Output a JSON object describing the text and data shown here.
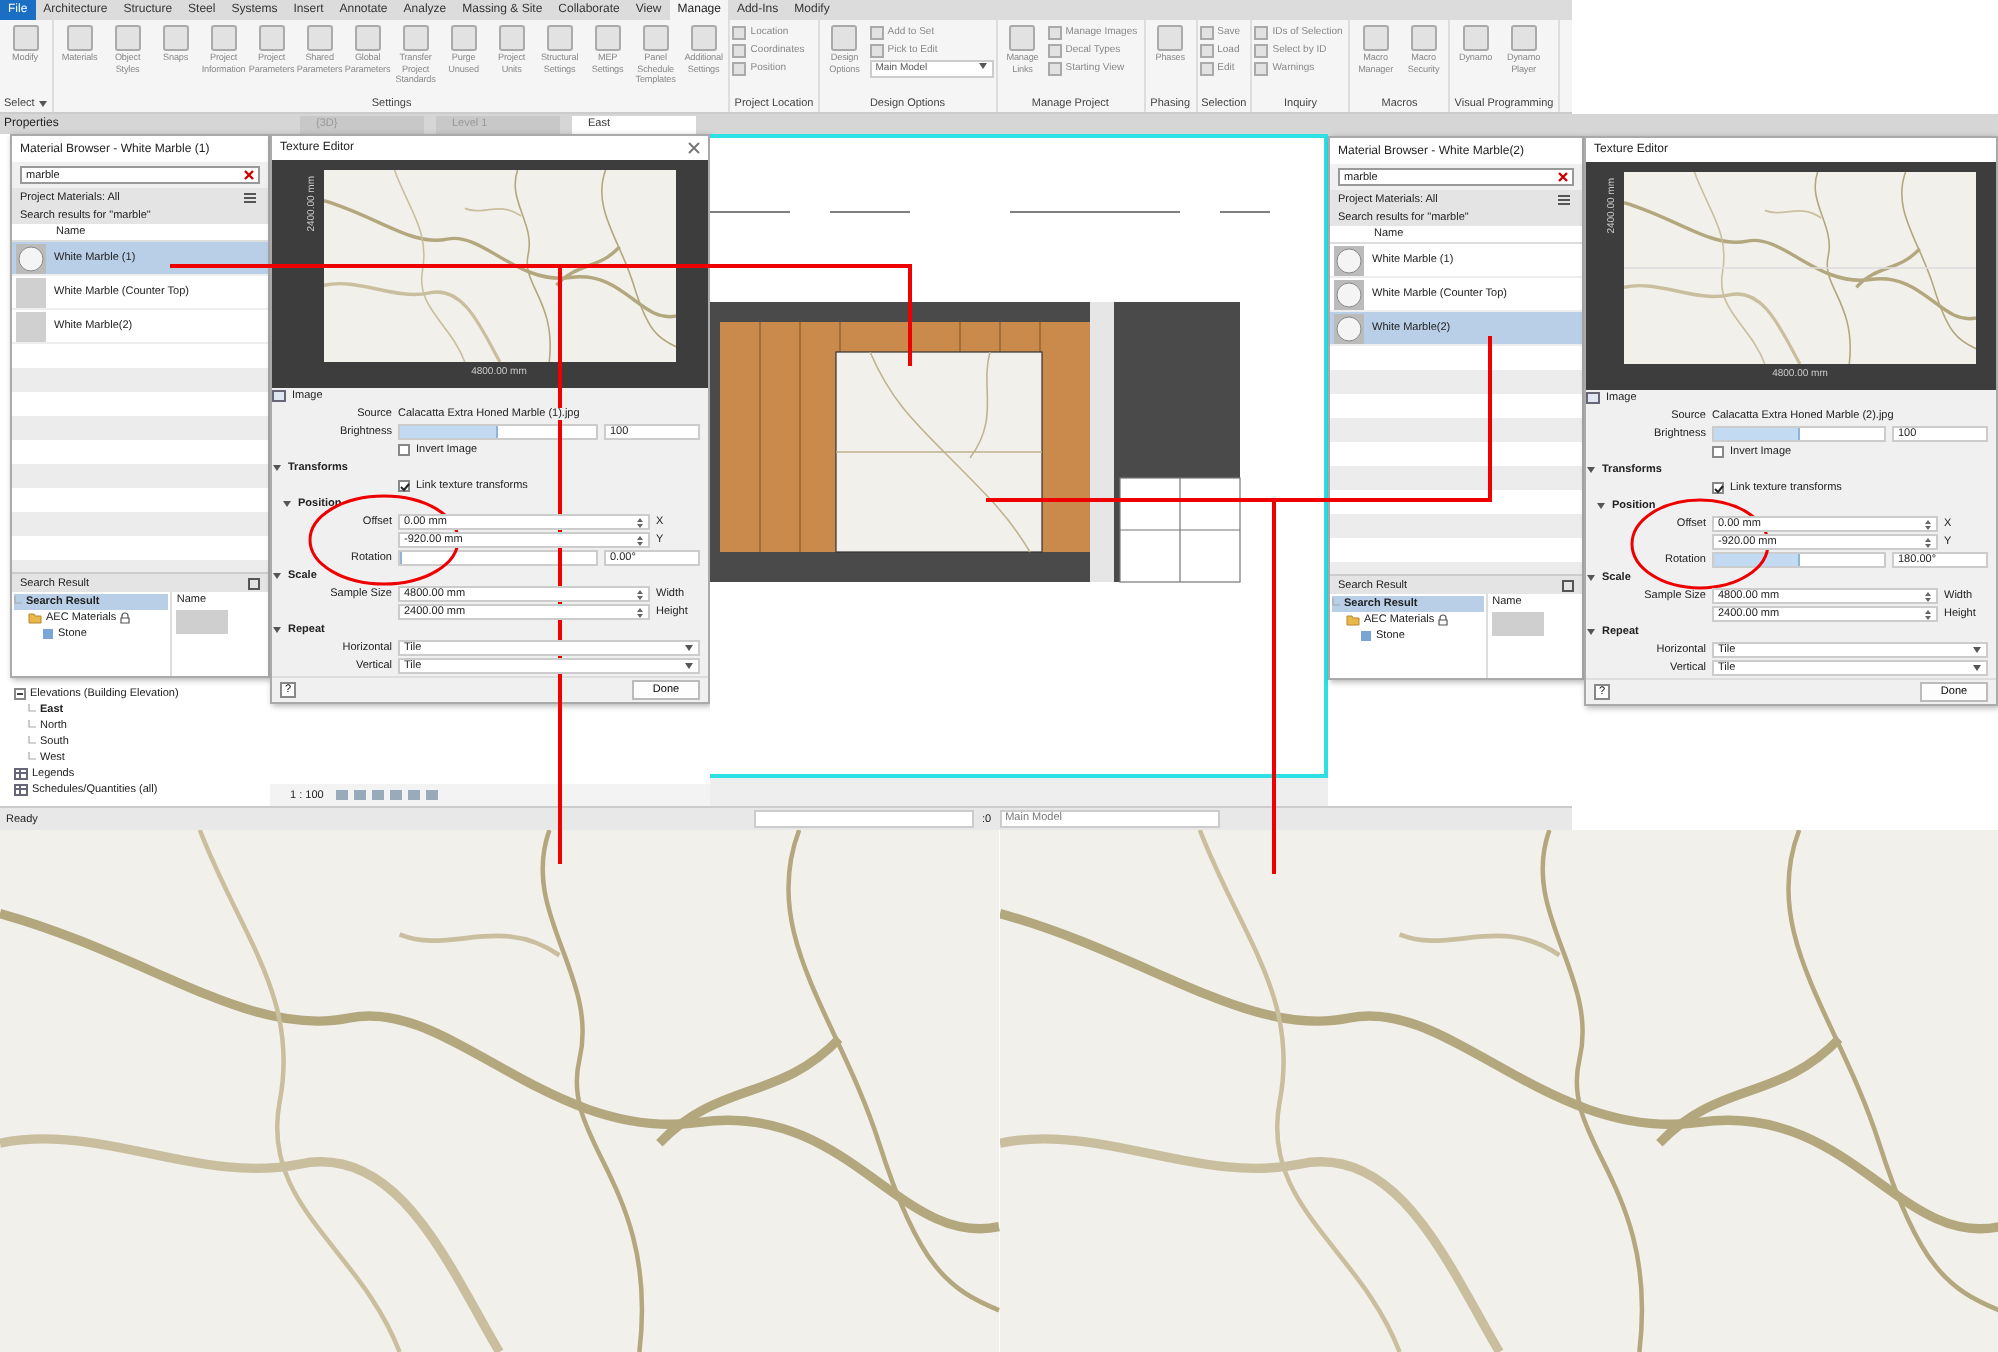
{
  "ribbon": {
    "tabs": [
      {
        "label": "File",
        "kind": "file",
        "selected": false
      },
      {
        "label": "Architecture",
        "kind": "tab",
        "selected": false
      },
      {
        "label": "Structure",
        "kind": "tab",
        "selected": false
      },
      {
        "label": "Steel",
        "kind": "tab",
        "selected": false
      },
      {
        "label": "Systems",
        "kind": "tab",
        "selected": false
      },
      {
        "label": "Insert",
        "kind": "tab",
        "selected": false
      },
      {
        "label": "Annotate",
        "kind": "tab",
        "selected": false
      },
      {
        "label": "Analyze",
        "kind": "tab",
        "selected": false
      },
      {
        "label": "Massing & Site",
        "kind": "tab",
        "selected": false
      },
      {
        "label": "Collaborate",
        "kind": "tab",
        "selected": false
      },
      {
        "label": "View",
        "kind": "tab",
        "selected": false
      },
      {
        "label": "Manage",
        "kind": "tab",
        "selected": true
      },
      {
        "label": "Add-Ins",
        "kind": "tab",
        "selected": false
      },
      {
        "label": "Modify",
        "kind": "tab",
        "selected": false
      }
    ],
    "groups": [
      {
        "label": "Select",
        "menu": true,
        "columns": [
          [
            {
              "label": "Modify",
              "kind": "large"
            }
          ]
        ]
      },
      {
        "label": "Settings",
        "menu": false,
        "columns": [
          [
            {
              "label": "Materials",
              "kind": "large"
            }
          ],
          [
            {
              "label": "Object Styles",
              "kind": "large"
            }
          ],
          [
            {
              "label": "Snaps",
              "kind": "large"
            }
          ],
          [
            {
              "label": "Project Information",
              "kind": "large"
            }
          ],
          [
            {
              "label": "Project Parameters",
              "kind": "large"
            }
          ],
          [
            {
              "label": "Shared Parameters",
              "kind": "large"
            }
          ],
          [
            {
              "label": "Global Parameters",
              "kind": "large"
            }
          ],
          [
            {
              "label": "Transfer Project Standards",
              "kind": "large"
            }
          ],
          [
            {
              "label": "Purge Unused",
              "kind": "large"
            }
          ],
          [
            {
              "label": "Project Units",
              "kind": "large"
            }
          ],
          [
            {
              "label": "Structural Settings",
              "kind": "large"
            }
          ],
          [
            {
              "label": "MEP Settings",
              "kind": "large"
            }
          ],
          [
            {
              "label": "Panel Schedule Templates",
              "kind": "large"
            }
          ],
          [
            {
              "label": "Additional Settings",
              "kind": "large"
            }
          ]
        ]
      },
      {
        "label": "Project Location",
        "menu": false,
        "columns": [
          [
            {
              "label": "Location",
              "kind": "small"
            },
            {
              "label": "Coordinates",
              "kind": "small"
            },
            {
              "label": "Position",
              "kind": "small"
            }
          ]
        ]
      },
      {
        "label": "Design Options",
        "menu": false,
        "columns": [
          [
            {
              "label": "Design Options",
              "kind": "large"
            }
          ],
          [
            {
              "label": "Add to Set",
              "kind": "small"
            },
            {
              "label": "Pick to Edit",
              "kind": "small"
            },
            {
              "label": "Main Model",
              "kind": "select"
            }
          ]
        ]
      },
      {
        "label": "Manage Project",
        "menu": false,
        "columns": [
          [
            {
              "label": "Manage Links",
              "kind": "large"
            }
          ],
          [
            {
              "label": "Manage Images",
              "kind": "small"
            },
            {
              "label": "Decal Types",
              "kind": "small"
            },
            {
              "label": "Starting View",
              "kind": "small"
            }
          ]
        ]
      },
      {
        "label": "Phasing",
        "menu": false,
        "columns": [
          [
            {
              "label": "Phases",
              "kind": "large"
            }
          ]
        ]
      },
      {
        "label": "Selection",
        "menu": false,
        "columns": [
          [
            {
              "label": "Save",
              "kind": "small"
            },
            {
              "label": "Load",
              "kind": "small"
            },
            {
              "label": "Edit",
              "kind": "small"
            }
          ]
        ]
      },
      {
        "label": "Inquiry",
        "menu": false,
        "columns": [
          [
            {
              "label": "IDs of Selection",
              "kind": "small"
            },
            {
              "label": "Select by ID",
              "kind": "small"
            },
            {
              "label": "Warnings",
              "kind": "small"
            }
          ]
        ]
      },
      {
        "label": "Macros",
        "menu": false,
        "columns": [
          [
            {
              "label": "Macro Manager",
              "kind": "large"
            }
          ],
          [
            {
              "label": "Macro Security",
              "kind": "large"
            }
          ]
        ]
      },
      {
        "label": "Visual Programming",
        "menu": false,
        "columns": [
          [
            {
              "label": "Dynamo",
              "kind": "large"
            }
          ],
          [
            {
              "label": "Dynamo Player",
              "kind": "large"
            }
          ]
        ]
      }
    ]
  },
  "properties_label": "Properties",
  "view_tabs": [
    {
      "label": "{3D}",
      "selected": false
    },
    {
      "label": "Level 1",
      "selected": false
    },
    {
      "label": "East",
      "selected": true
    }
  ],
  "left": {
    "browser": {
      "title": "Material Browser - White Marble (1)",
      "search": "marble",
      "filter": "Project Materials: All",
      "results_label": "Search results for \"marble\"",
      "column": "Name",
      "items": [
        {
          "name": "White Marble (1)",
          "kind": "sphere",
          "selected": true
        },
        {
          "name": "White Marble (Counter Top)",
          "kind": "swatch",
          "selected": false
        },
        {
          "name": "White Marble(2)",
          "kind": "swatch",
          "selected": false
        }
      ],
      "library": {
        "dropdown": "Search Result",
        "column": "Name",
        "tree": [
          {
            "label": "Search Result",
            "kind": "leaf",
            "selected": true,
            "children": [
              {
                "label": "AEC Materials",
                "kind": "folder",
                "selected": false,
                "children": [
                  {
                    "label": "Stone",
                    "kind": "material",
                    "selected": false
                  }
                ]
              }
            ]
          }
        ]
      }
    },
    "editor": {
      "title": "Texture Editor",
      "closable": true,
      "height_dim": "2400.00 mm",
      "width_dim": "4800.00 mm",
      "image_label": "Image",
      "source_label": "Source",
      "source": "Calacatta Extra Honed Marble (1).jpg",
      "brightness_label": "Brightness",
      "brightness": {
        "level": 0.5,
        "reading": "100"
      },
      "invert": {
        "label": "Invert Image",
        "checked": false
      },
      "transforms_label": "Transforms",
      "link": {
        "label": "Link texture transforms",
        "checked": true
      },
      "position_label": "Position",
      "offset_label": "Offset",
      "offset_x": "0.00 mm",
      "x_label": "X",
      "offset_y": "-920.00 mm",
      "y_label": "Y",
      "rotation_label": "Rotation",
      "rotation": {
        "level": 0,
        "reading": "0.00°"
      },
      "scale_label": "Scale",
      "sample_label": "Sample Size",
      "width_value": "4800.00 mm",
      "width_label": "Width",
      "height_value": "2400.00 mm",
      "height_label": "Height",
      "repeat_label": "Repeat",
      "horizontal_label": "Horizontal",
      "horizontal": "Tile",
      "vertical_label": "Vertical",
      "vertical": "Tile",
      "help": "?",
      "done": "Done"
    }
  },
  "project_tree": [
    {
      "label": "Elevations (Building Elevation)",
      "kind": "group",
      "selected": false,
      "children": [
        {
          "label": "East",
          "kind": "leaf",
          "selected": true
        },
        {
          "label": "North",
          "kind": "leaf",
          "selected": false
        },
        {
          "label": "South",
          "kind": "leaf",
          "selected": false
        },
        {
          "label": "West",
          "kind": "leaf",
          "selected": false
        }
      ]
    },
    {
      "label": "Legends",
      "kind": "category",
      "selected": false
    },
    {
      "label": "Schedules/Quantities (all)",
      "kind": "category",
      "selected": false
    }
  ],
  "view_scale": "1 : 100",
  "right": {
    "browser": {
      "title": "Material Browser - White Marble(2)",
      "search": "marble",
      "filter": "Project Materials: All",
      "results_label": "Search results for \"marble\"",
      "column": "Name",
      "items": [
        {
          "name": "White Marble (1)",
          "kind": "sphere",
          "selected": false
        },
        {
          "name": "White Marble (Counter Top)",
          "kind": "sphere",
          "selected": false
        },
        {
          "name": "White Marble(2)",
          "kind": "sphere",
          "selected": true
        }
      ],
      "library": {
        "dropdown": "Search Result",
        "column": "Name",
        "tree": [
          {
            "label": "Search Result",
            "kind": "leaf",
            "selected": true,
            "children": [
              {
                "label": "AEC Materials",
                "kind": "folder",
                "selected": false,
                "children": [
                  {
                    "label": "Stone",
                    "kind": "material",
                    "selected": false
                  }
                ]
              }
            ]
          }
        ]
      }
    },
    "editor": {
      "title": "Texture Editor",
      "closable": false,
      "height_dim": "2400.00 mm",
      "width_dim": "4800.00 mm",
      "image_label": "Image",
      "source_label": "Source",
      "source": "Calacatta Extra Honed Marble (2).jpg",
      "brightness_label": "Brightness",
      "brightness": {
        "level": 0.5,
        "reading": "100"
      },
      "invert": {
        "label": "Invert Image",
        "checked": false
      },
      "transforms_label": "Transforms",
      "link": {
        "label": "Link texture transforms",
        "checked": true
      },
      "position_label": "Position",
      "offset_label": "Offset",
      "offset_x": "0.00 mm",
      "x_label": "X",
      "offset_y": "-920.00 mm",
      "y_label": "Y",
      "rotation_label": "Rotation",
      "rotation": {
        "level": 0.5,
        "reading": "180.00°"
      },
      "scale_label": "Scale",
      "sample_label": "Sample Size",
      "width_value": "4800.00 mm",
      "width_label": "Width",
      "height_value": "2400.00 mm",
      "height_label": "Height",
      "repeat_label": "Repeat",
      "horizontal_label": "Horizontal",
      "horizontal": "Tile",
      "vertical_label": "Vertical",
      "vertical": "Tile",
      "help": "?",
      "done": "Done"
    }
  },
  "status_bar": {
    "text": "Ready",
    "count": ":0",
    "model": "Main Model"
  }
}
